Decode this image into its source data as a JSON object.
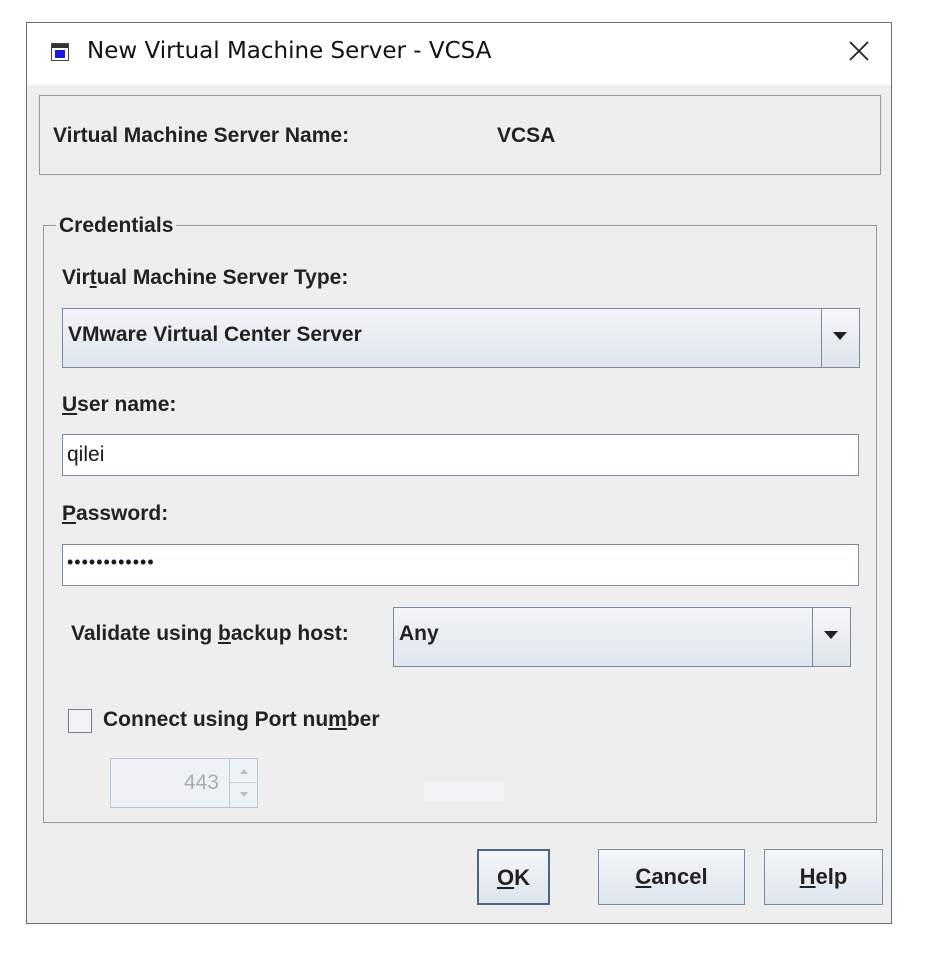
{
  "window": {
    "title": "New Virtual Machine Server - VCSA"
  },
  "name_panel": {
    "label": "Virtual Machine Server Name:",
    "value": "VCSA"
  },
  "credentials": {
    "legend": "Credentials",
    "server_type": {
      "label_pre": "Vir",
      "label_mn": "t",
      "label_post": "ual Machine Server Type:",
      "value": "VMware Virtual Center Server"
    },
    "username": {
      "label_mn": "U",
      "label_post": "ser name:",
      "value": "qilei"
    },
    "password": {
      "label_mn": "P",
      "label_post": "assword:",
      "value": "••••••••••••"
    },
    "backup_host": {
      "label_pre": "Validate using ",
      "label_mn": "b",
      "label_post": "ackup host:",
      "value": "Any"
    },
    "port": {
      "checkbox_pre": "Connect using Port nu",
      "checkbox_mn": "m",
      "checkbox_post": "ber",
      "checked": false,
      "value": "443"
    }
  },
  "buttons": {
    "ok": {
      "mn": "O",
      "post": "K"
    },
    "cancel": {
      "mn": "C",
      "post": "ancel"
    },
    "help": {
      "mn": "H",
      "post": "elp"
    }
  },
  "icons": {
    "app": "app-window-icon",
    "close": "close-icon",
    "dropdown": "chevron-down-icon",
    "spin_up": "spin-up-icon",
    "spin_down": "spin-down-icon"
  }
}
